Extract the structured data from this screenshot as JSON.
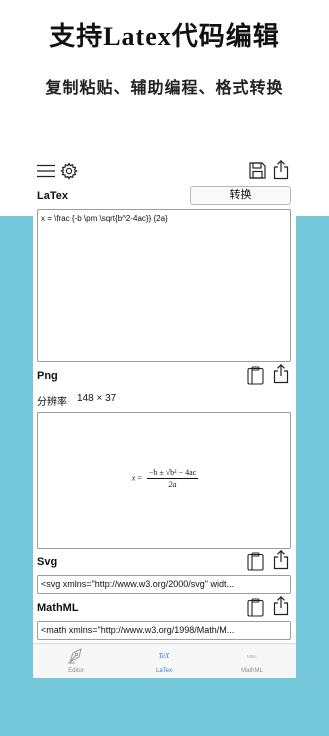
{
  "promo": {
    "title": "支持Latex代码编辑",
    "subtitle": "复制粘贴、辅助编程、格式转换"
  },
  "toolbar": {
    "menu_icon": "hamburger-menu-icon",
    "settings_icon": "gear-icon",
    "save_icon": "save-floppy-icon",
    "share_icon": "share-icon"
  },
  "latex_section": {
    "label": "LaTex",
    "convert_button": "转换",
    "input_value": "x = \\frac {-b \\pm \\sqrt{b^2-4ac}} {2a}"
  },
  "png_section": {
    "label": "Png",
    "resolution_label": "分辨率",
    "resolution_value": "148 × 37",
    "rendered_formula": {
      "lhs": "x",
      "equals": "=",
      "numerator": "−b ± √b² − 4ac",
      "denominator": "2a"
    }
  },
  "svg_section": {
    "label": "Svg",
    "value": "<svg xmlns=\"http://www.w3.org/2000/svg\" widt..."
  },
  "mathml_section": {
    "label": "MathML",
    "value": "<math xmlns=\"http://www.w3.org/1998/Math/M..."
  },
  "tabs": [
    {
      "label": "Editor",
      "icon": "pen-nib-icon",
      "active": false
    },
    {
      "label": "LaTex",
      "icon": "tex-icon",
      "icon_text": "TeX",
      "active": true
    },
    {
      "label": "MathML",
      "icon": "mathml-icon",
      "icon_text": "MML",
      "active": false
    }
  ],
  "colors": {
    "background_band": "#73c7d9",
    "active_tab": "#2f7be5",
    "inactive_tab": "#8e8e93"
  }
}
